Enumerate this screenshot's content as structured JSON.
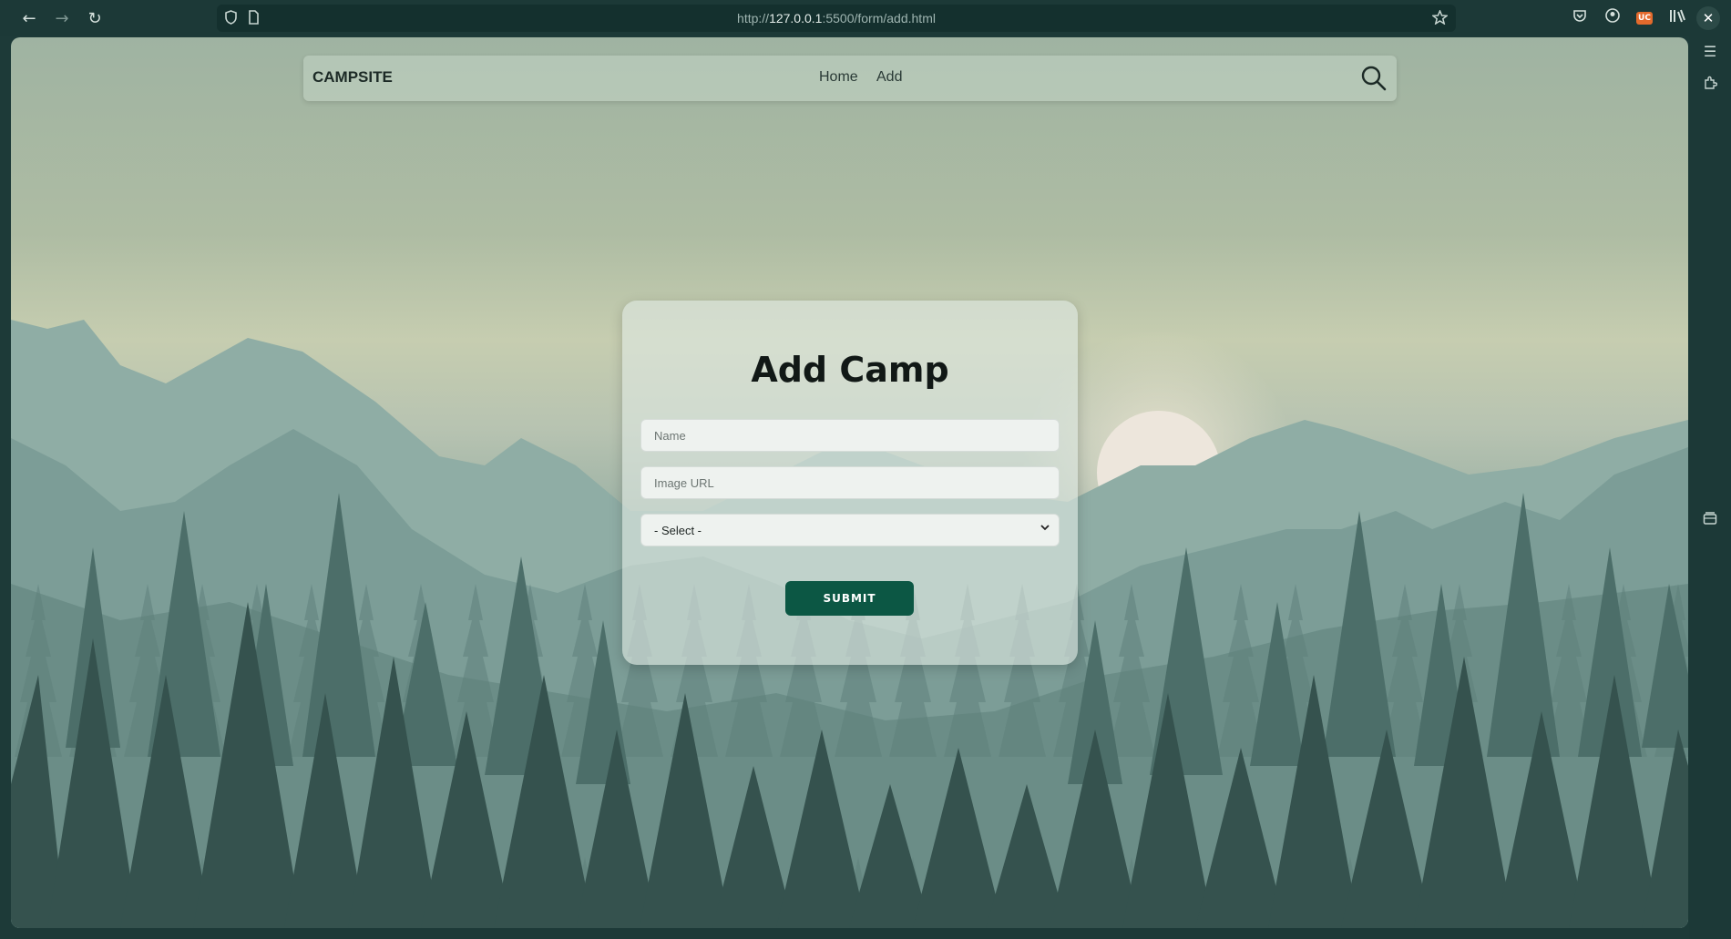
{
  "browser": {
    "url_prefix": "http://",
    "url_host": "127.0.0.1",
    "url_path": ":5500/form/add.html",
    "icons": [
      "back-arrow-icon",
      "forward-arrow-icon",
      "reload-icon",
      "shield-icon",
      "page-icon",
      "star-icon",
      "pocket-icon",
      "account-icon",
      "ublock-icon",
      "reader-icon",
      "close-icon",
      "menu-icon",
      "extensions-icon",
      "tabs-folder-icon"
    ],
    "ublock_badge": "UC"
  },
  "navbar": {
    "brand": "CAMPSITE",
    "links": [
      {
        "label": "Home"
      },
      {
        "label": "Add"
      }
    ],
    "search_icon": "search-icon"
  },
  "form": {
    "title": "Add Camp",
    "name_placeholder": "Name",
    "image_url_placeholder": "Image URL",
    "select_value": "- Select -",
    "submit_label": "SUBMIT"
  },
  "colors": {
    "accent": "#0c5744",
    "chrome_bg": "#1c3937"
  }
}
